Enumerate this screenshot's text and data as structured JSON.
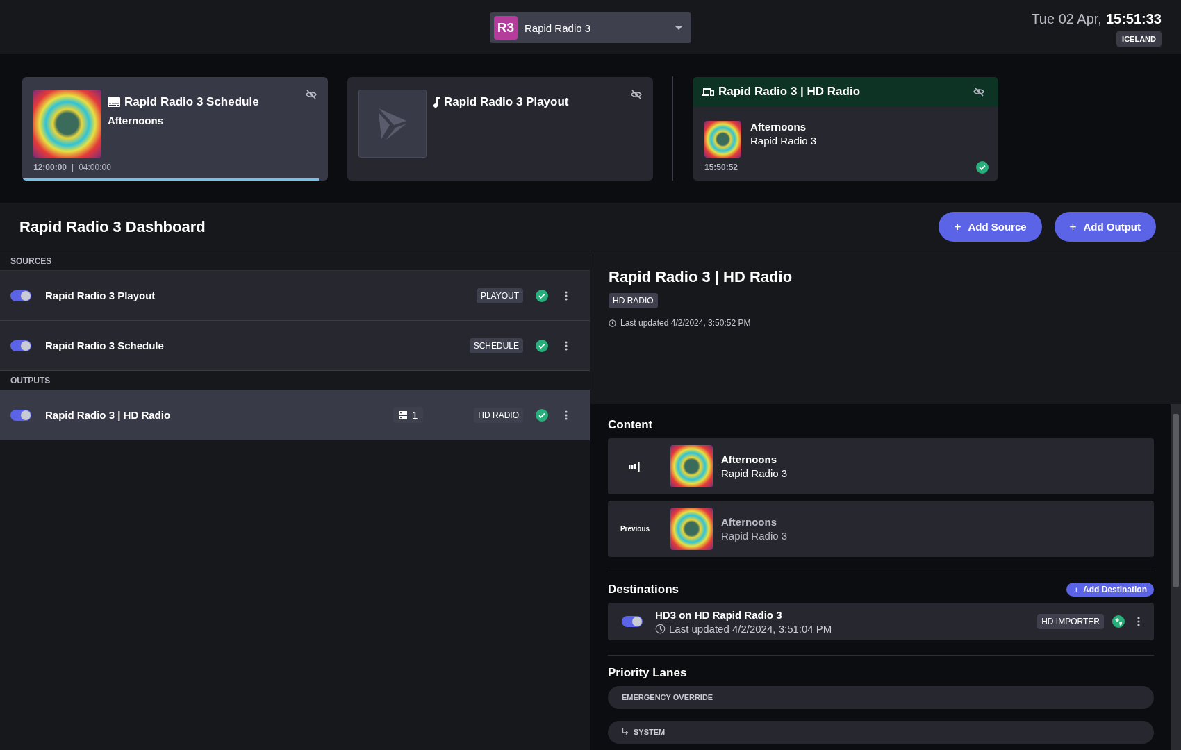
{
  "top_bar": {
    "station": {
      "badge": "R3",
      "name": "Rapid Radio 3"
    },
    "date": "Tue 02 Apr,",
    "time": "15:51:33",
    "timezone": "ICELAND"
  },
  "cards": [
    {
      "kind": "schedule",
      "title": "Rapid Radio 3 Schedule",
      "subtitle": "Afternoons",
      "start": "12:00:00",
      "separator": "|",
      "duration": "04:00:00",
      "level": 0.97,
      "selected": true,
      "has_art": true
    },
    {
      "kind": "playout",
      "title": "Rapid Radio 3 Playout",
      "selected": false,
      "has_art": false
    },
    {
      "kind": "output",
      "title": "Rapid Radio 3 | HD Radio",
      "subtitle": "Afternoons",
      "artist": "Rapid Radio 3",
      "time": "15:50:52",
      "ok": true,
      "selected": false
    }
  ],
  "dashboard": {
    "title": "Rapid Radio 3 Dashboard",
    "buttons": [
      {
        "icon": "+",
        "label": "Add Source"
      },
      {
        "icon": "+",
        "label": "Add Output"
      }
    ]
  },
  "sources": {
    "heading": "SOURCES",
    "items": [
      {
        "name": "Rapid Radio 3 Playout",
        "enabled": true,
        "type": "PLAYOUT",
        "ok": true,
        "selected": false
      },
      {
        "name": "Rapid Radio 3 Schedule",
        "enabled": true,
        "type": "SCHEDULE",
        "ok": true,
        "selected": false
      }
    ]
  },
  "outputs": {
    "heading": "OUTPUTS",
    "items": [
      {
        "name": "Rapid Radio 3 | HD Radio",
        "enabled": true,
        "destinations": "1",
        "type": "HD RADIO",
        "ok": true,
        "selected": true
      }
    ]
  },
  "detail": {
    "title": "Rapid Radio 3 | HD Radio",
    "type": "HD RADIO",
    "updated": "Last updated 4/2/2024, 3:50:52 PM",
    "content": {
      "title": "Content",
      "items": [
        {
          "kind": "now",
          "title": "Afternoons",
          "artist": "Rapid Radio 3"
        },
        {
          "kind": "previous",
          "label": "Previous",
          "title": "Afternoons",
          "artist": "Rapid Radio 3"
        }
      ]
    },
    "destinations": {
      "title": "Destinations",
      "button": {
        "icon": "+",
        "label": "Add Destination"
      },
      "items": [
        {
          "name": "HD3 on HD Rapid Radio 3",
          "enabled": true,
          "updated": "Last updated 4/2/2024, 3:51:04 PM",
          "type": "HD IMPORTER",
          "connected": true
        }
      ]
    },
    "priority_lanes": {
      "title": "Priority Lanes",
      "items": [
        {
          "name": "EMERGENCY OVERRIDE",
          "children": [
            {
              "name": "SYSTEM"
            }
          ]
        }
      ]
    }
  }
}
